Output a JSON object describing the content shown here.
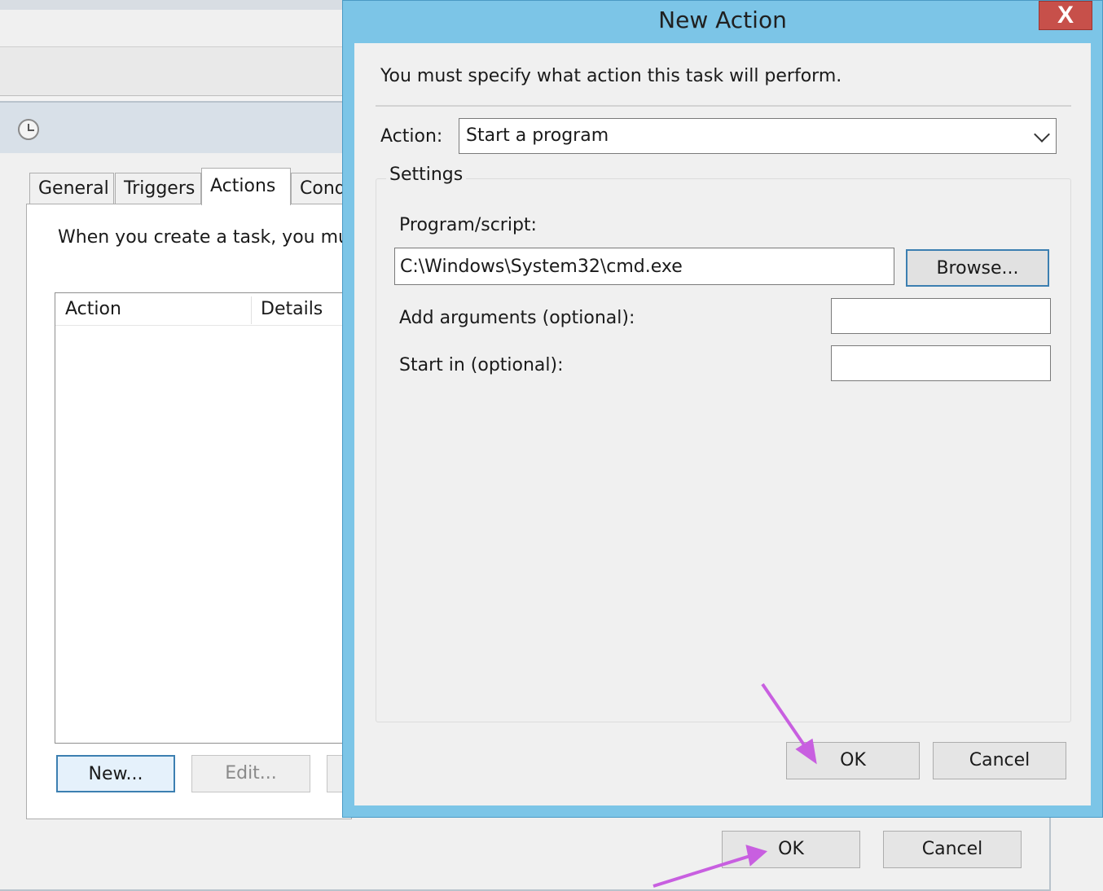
{
  "task_window": {
    "tabs": [
      {
        "label": "General"
      },
      {
        "label": "Triggers"
      },
      {
        "label": "Actions"
      },
      {
        "label": "Cond"
      }
    ],
    "panel_text": "When you create a task, you mus",
    "list": {
      "col_action": "Action",
      "col_details": "Details"
    },
    "buttons": {
      "new": "New...",
      "edit": "Edit...",
      "ok": "OK",
      "cancel": "Cancel"
    }
  },
  "dialog": {
    "title": "New Action",
    "close": "X",
    "intro": "You must specify what action this task will perform.",
    "action_label": "Action:",
    "action_value": "Start a program",
    "settings_legend": "Settings",
    "program_label": "Program/script:",
    "program_value": "C:\\Windows\\System32\\cmd.exe",
    "browse": "Browse...",
    "arguments_label": "Add arguments (optional):",
    "arguments_value": "",
    "start_in_label": "Start in (optional):",
    "start_in_value": "",
    "ok": "OK",
    "cancel": "Cancel"
  },
  "colors": {
    "dialog_frame": "#7cc5e7",
    "close_button": "#c7504a",
    "arrow": "#c85fe0"
  }
}
